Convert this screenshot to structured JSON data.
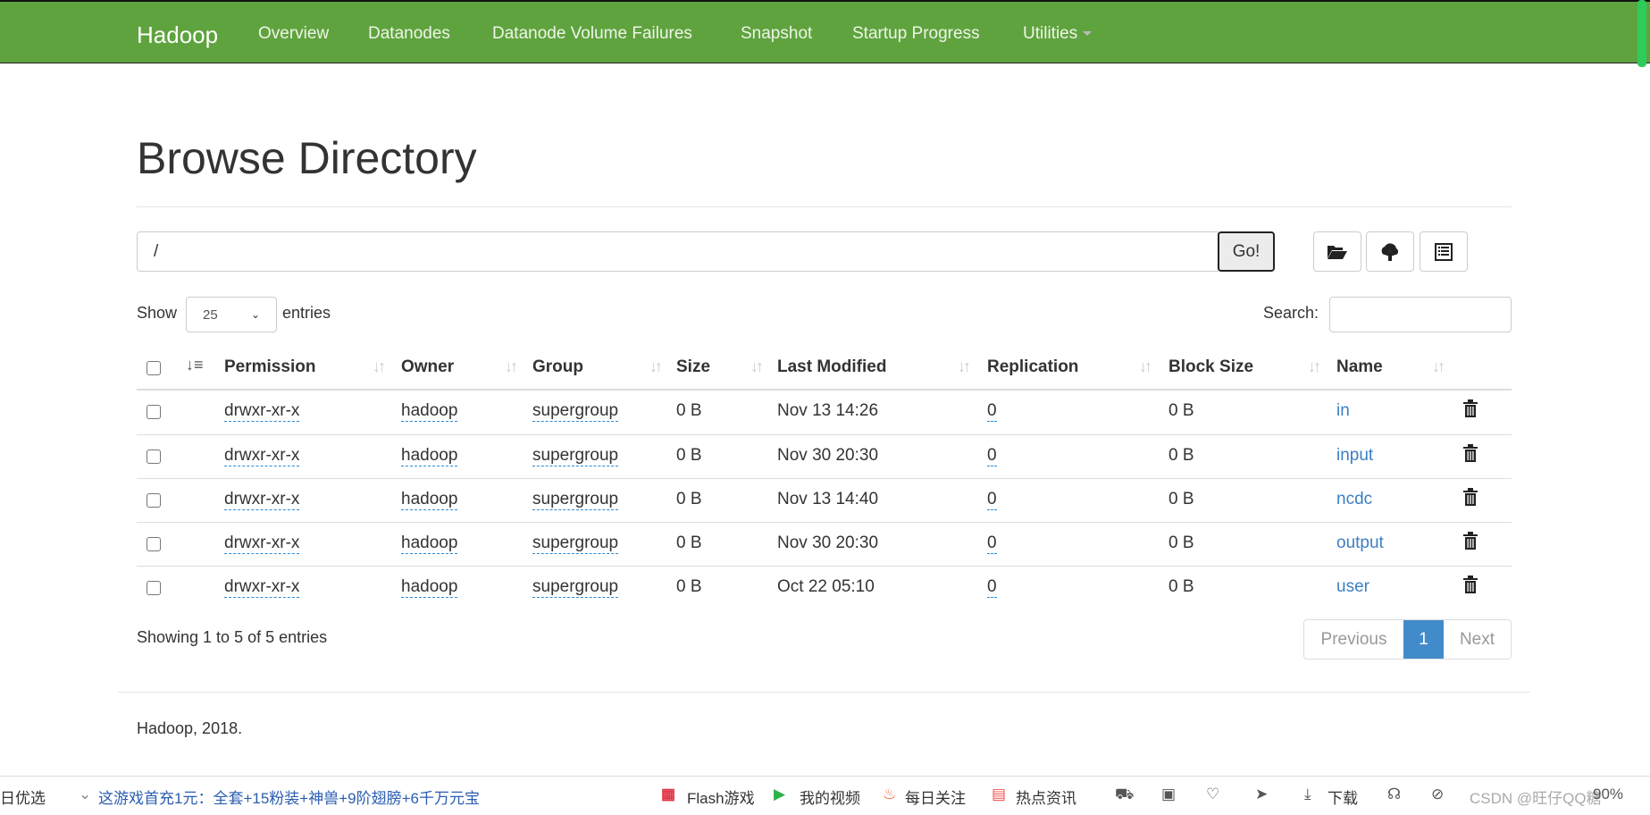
{
  "nav": {
    "brand": "Hadoop",
    "items": [
      "Overview",
      "Datanodes",
      "Datanode Volume Failures",
      "Snapshot",
      "Startup Progress",
      "Utilities"
    ]
  },
  "page": {
    "title": "Browse Directory",
    "path": "/",
    "go": "Go!"
  },
  "toolbar": {
    "icons": [
      "folder-open-icon",
      "cloud-upload-icon",
      "list-icon"
    ]
  },
  "controls": {
    "show": "Show",
    "entries_value": "25",
    "entries": "entries",
    "search": "Search:"
  },
  "table": {
    "headers": [
      "Permission",
      "Owner",
      "Group",
      "Size",
      "Last Modified",
      "Replication",
      "Block Size",
      "Name"
    ],
    "rows": [
      [
        "drwxr-xr-x",
        "hadoop",
        "supergroup",
        "0 B",
        "Nov 13 14:26",
        "0",
        "0 B",
        "in"
      ],
      [
        "drwxr-xr-x",
        "hadoop",
        "supergroup",
        "0 B",
        "Nov 30 20:30",
        "0",
        "0 B",
        "input"
      ],
      [
        "drwxr-xr-x",
        "hadoop",
        "supergroup",
        "0 B",
        "Nov 13 14:40",
        "0",
        "0 B",
        "ncdc"
      ],
      [
        "drwxr-xr-x",
        "hadoop",
        "supergroup",
        "0 B",
        "Nov 30 20:30",
        "0",
        "0 B",
        "output"
      ],
      [
        "drwxr-xr-x",
        "hadoop",
        "supergroup",
        "0 B",
        "Oct 22 05:10",
        "0",
        "0 B",
        "user"
      ]
    ]
  },
  "info": "Showing 1 to 5 of 5 entries",
  "pager": {
    "prev": "Previous",
    "page": "1",
    "next": "Next"
  },
  "footer": "Hadoop, 2018.",
  "browser_bar": {
    "left": "日优选",
    "ad": "这游戏首充1元：全套+15粉装+神兽+9阶翅膀+6千万元宝",
    "flash": "Flash游戏",
    "video": "我的视频",
    "daily": "每日关注",
    "news": "热点资讯",
    "download": "下载",
    "zoom": "90%",
    "watermark": "CSDN @旺仔QQ糖"
  },
  "colors": {
    "navbar": "#5fa33e",
    "link": "#3b7fc4",
    "active_page": "#428bca"
  }
}
